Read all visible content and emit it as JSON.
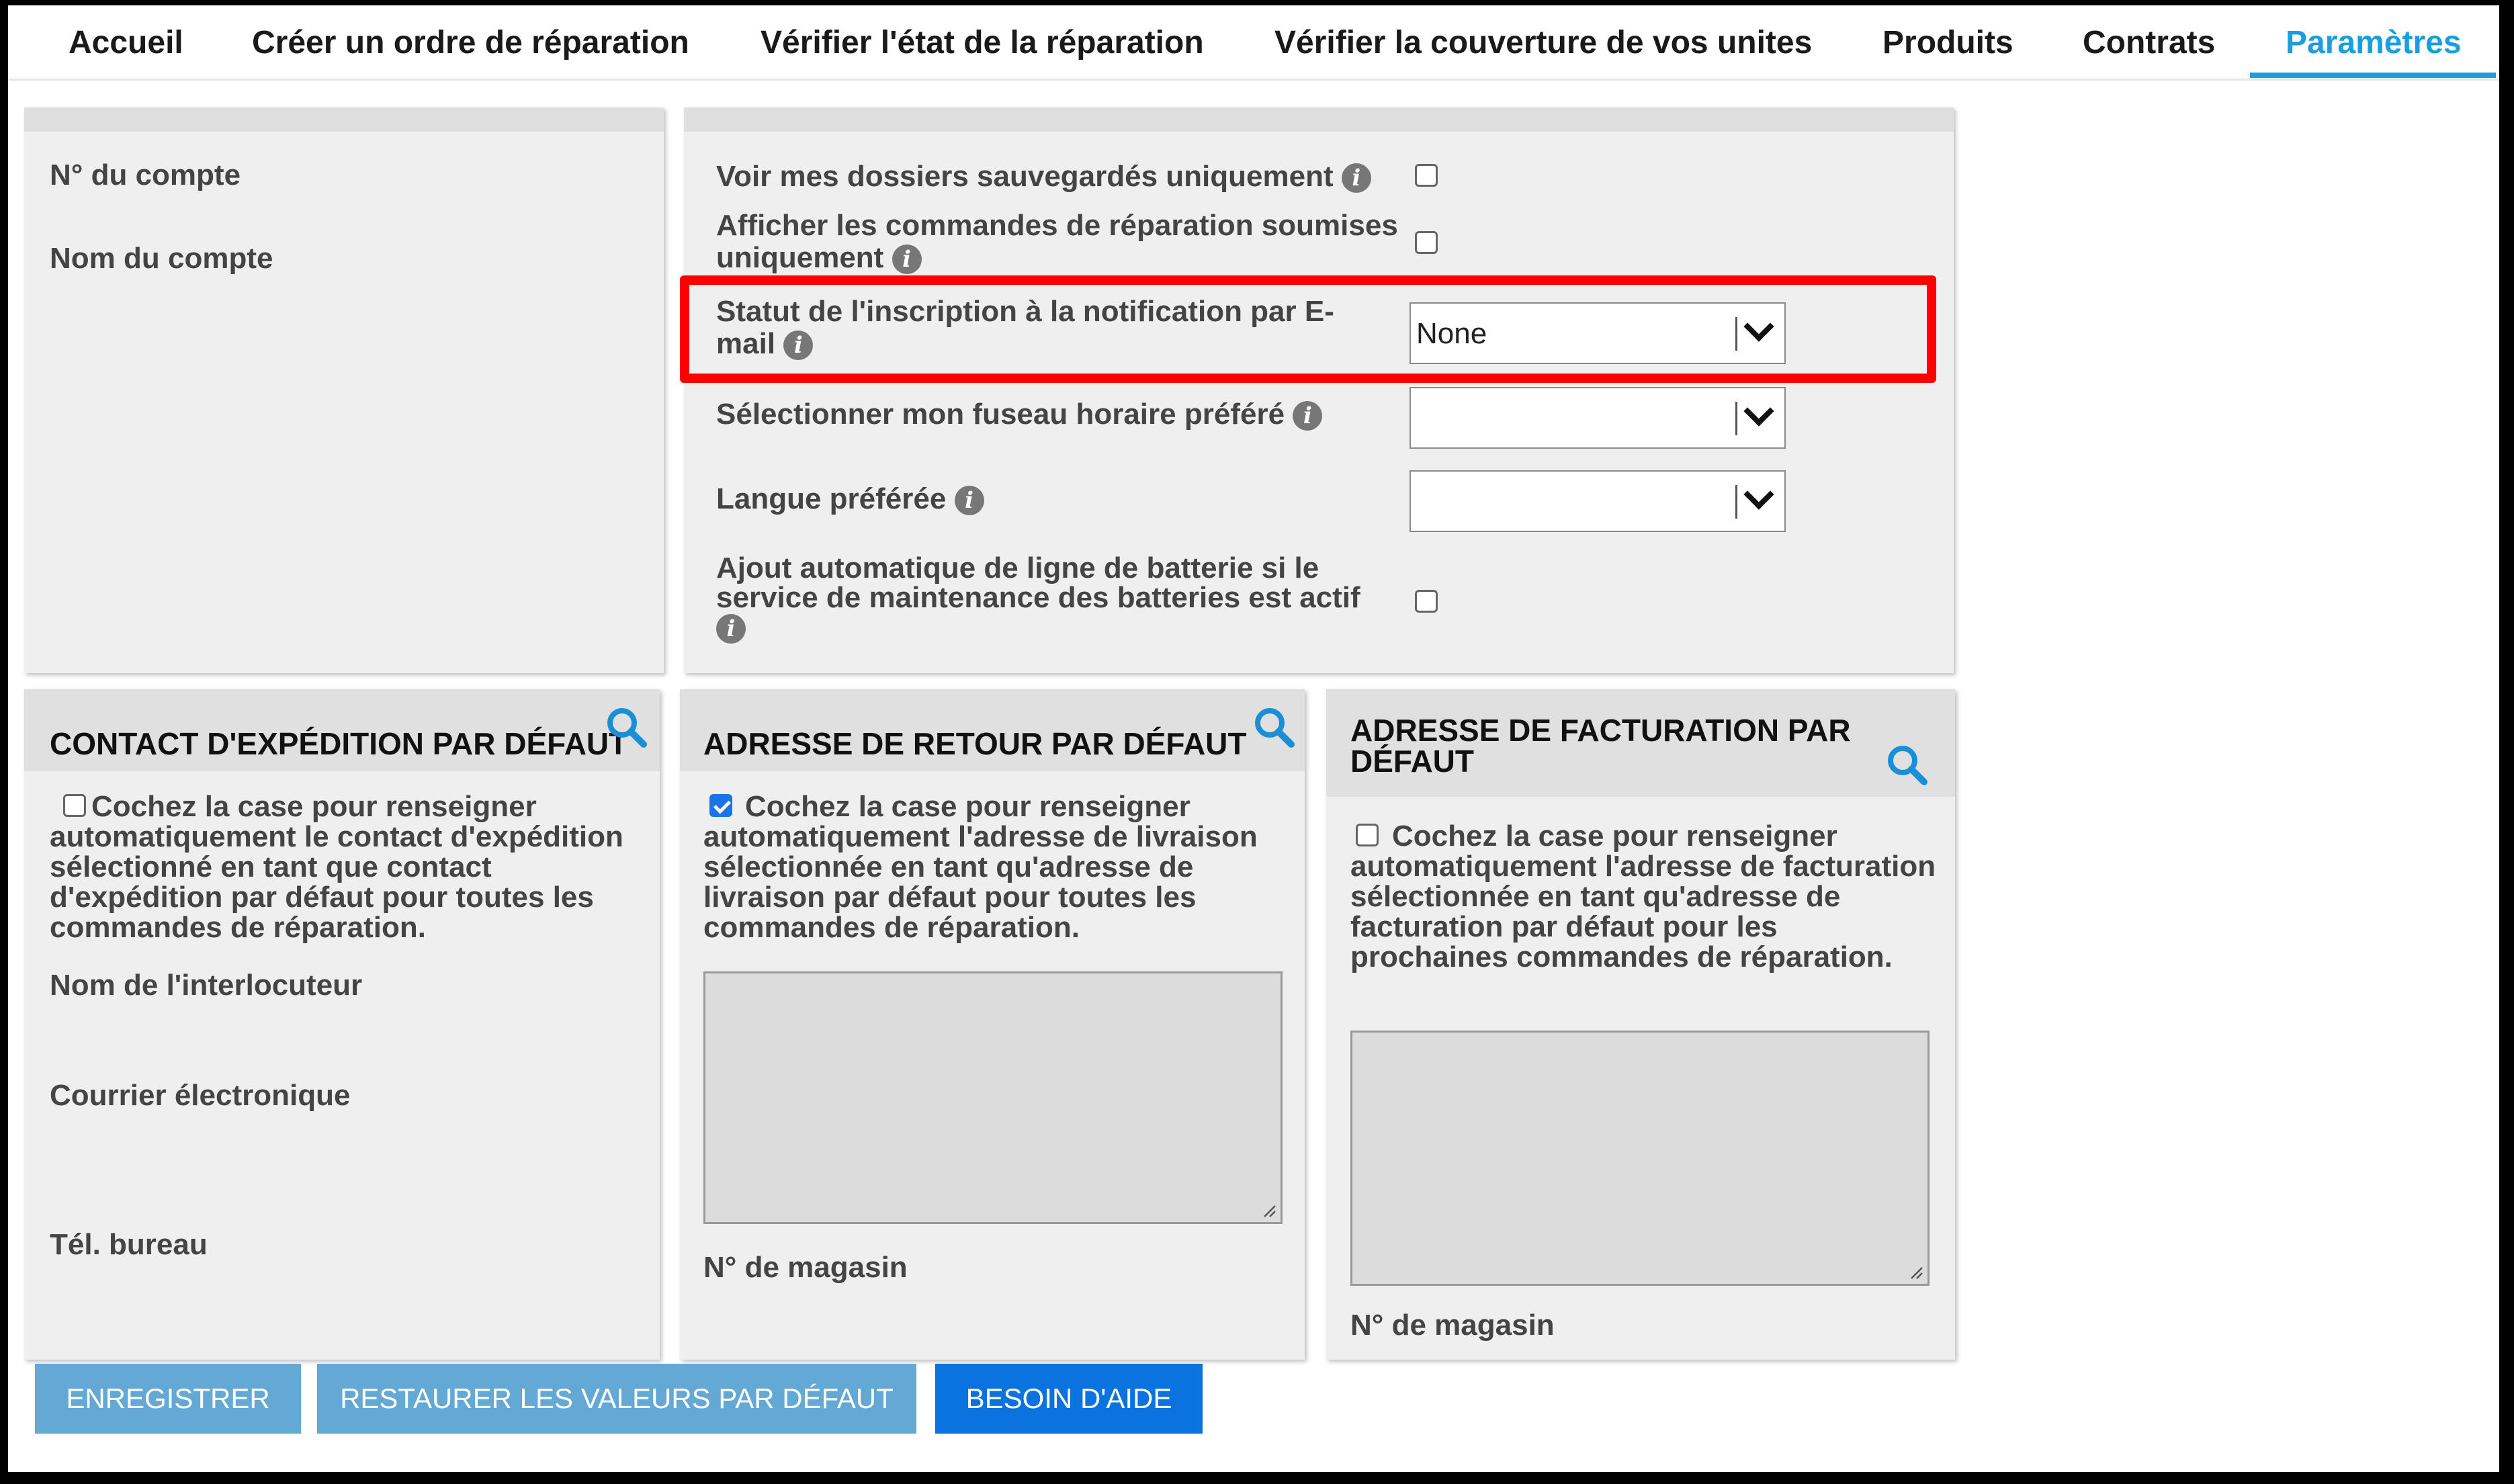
{
  "nav": {
    "items": [
      {
        "label": "Accueil"
      },
      {
        "label": "Créer un ordre de réparation"
      },
      {
        "label": "Vérifier l'état de la réparation"
      },
      {
        "label": "Vérifier la couverture de vos unites"
      },
      {
        "label": "Produits"
      },
      {
        "label": "Contrats"
      },
      {
        "label": "Paramètres",
        "active": true
      }
    ]
  },
  "account": {
    "number_label": "N° du compte",
    "name_label": "Nom du compte"
  },
  "preferences": {
    "saved_files_label": "Voir mes dossiers sauvegardés uniquement",
    "saved_files_checked": false,
    "submitted_orders_label": "Afficher les commandes de réparation soumises uniquement",
    "submitted_orders_checked": false,
    "email_notification_label": "Statut de l'inscription à la notification par E-mail",
    "email_notification_value": "None",
    "timezone_label": "Sélectionner mon fuseau horaire préféré",
    "timezone_value": "",
    "language_label": "Langue préférée",
    "language_value": "",
    "battery_line_label": "Ajout automatique de ligne de batterie si le service de maintenance des batteries est actif",
    "battery_line_checked": false,
    "info_glyph": "i"
  },
  "shipping_contact": {
    "title": "CONTACT D'EXPÉDITION PAR DÉFAUT",
    "checkbox_text": "Cochez la case pour renseigner automatiquement le contact d'expédition sélectionné en tant que contact d'expédition par défaut pour toutes les commandes de réparation.",
    "checked": false,
    "contact_name_label": "Nom de l'interlocuteur",
    "email_label": "Courrier électronique",
    "office_phone_label": "Tél. bureau"
  },
  "return_address": {
    "title": "ADRESSE DE RETOUR PAR DÉFAUT",
    "checkbox_text": "Cochez la case pour renseigner automatiquement l'adresse de livraison sélectionnée en tant qu'adresse de livraison par défaut pour toutes les commandes de réparation.",
    "checked": true,
    "store_label": "N° de magasin"
  },
  "billing_address": {
    "title": "ADRESSE DE FACTURATION PAR DÉFAUT",
    "checkbox_text": "Cochez la case pour renseigner automatiquement l'adresse de facturation sélectionnée en tant qu'adresse de facturation par défaut pour les prochaines commandes de réparation.",
    "checked": false,
    "store_label": "N° de magasin"
  },
  "buttons": {
    "save": "ENREGISTRER",
    "restore": "RESTAURER LES VALEURS PAR DÉFAUT",
    "help": "BESOIN D'AIDE"
  },
  "colors": {
    "accent": "#1a9ee0",
    "highlight": "#ff0000",
    "button_light": "#64a9d6",
    "button_dark": "#0a73e0",
    "search_icon": "#1a8fd6"
  },
  "icons": [
    "info-icon",
    "search-icon",
    "chevron-down-icon",
    "checkbox-icon",
    "resize-grip-icon"
  ]
}
